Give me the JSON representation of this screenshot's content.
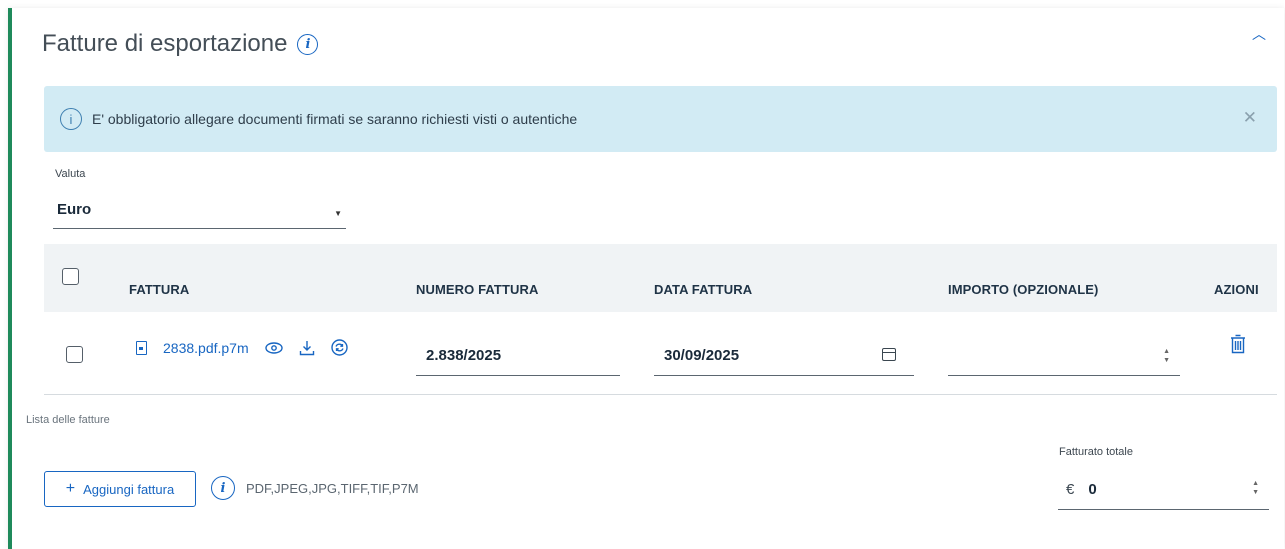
{
  "section": {
    "title": "Fatture di esportazione",
    "info_icon": "info-italic-icon",
    "collapse_icon": "chevron-up-icon"
  },
  "alert": {
    "text": "E' obbligatorio allegare documenti firmati se saranno richiesti visti o autentiche",
    "icon": "info-circle-icon",
    "close_icon": "close-icon",
    "background": "#d2ebf4"
  },
  "valuta": {
    "label": "Valuta",
    "value": "Euro"
  },
  "table": {
    "headers": {
      "fattura": "FATTURA",
      "numero": "NUMERO FATTURA",
      "data": "DATA FATTURA",
      "importo": "IMPORTO (OPZIONALE)",
      "azioni": "AZIONI"
    },
    "rows": [
      {
        "file_name": "2838.pdf.p7m",
        "numero": "2.838/2025",
        "data": "30/09/2025",
        "importo": ""
      }
    ],
    "caption": "Lista delle fatture"
  },
  "footer": {
    "add_button": "Aggiungi fattura",
    "formats": "PDF,JPEG,JPG,TIFF,TIF,P7M",
    "total_label": "Fatturato totale",
    "currency": "€",
    "total_value": "0"
  },
  "colors": {
    "accent": "#1866c2",
    "left_border": "#1f8a5b",
    "table_header_bg": "#f0f3f5"
  }
}
